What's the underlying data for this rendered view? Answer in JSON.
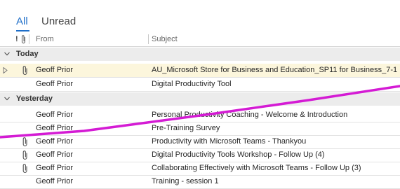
{
  "tabs": [
    {
      "label": "All",
      "selected": true
    },
    {
      "label": "Unread",
      "selected": false
    }
  ],
  "columns": {
    "importance_icon": "exclamation-icon",
    "attachment_icon": "paperclip-icon",
    "from": "From",
    "subject": "Subject"
  },
  "groups": [
    {
      "label": "Today",
      "messages": [
        {
          "from": "Geoff Prior",
          "subject": "AU_Microsoft Store for Business and Education_SP11 for Business_7-1",
          "attachment": true,
          "selected": true
        },
        {
          "from": "Geoff Prior",
          "subject": "Digital Productivity Tool",
          "attachment": false,
          "selected": false
        }
      ]
    },
    {
      "label": "Yesterday",
      "messages": [
        {
          "from": "Geoff Prior",
          "subject": "Personal Productivity Coaching - Welcome & Introduction",
          "attachment": false
        },
        {
          "from": "Geoff Prior",
          "subject": "Pre-Training Survey",
          "attachment": false
        },
        {
          "from": "Geoff Prior",
          "subject": "Productivity with Microsoft Teams - Thankyou",
          "attachment": true
        },
        {
          "from": "Geoff Prior",
          "subject": "Digital Productivity Tools Workshop - Follow Up (4)",
          "attachment": true
        },
        {
          "from": "Geoff Prior",
          "subject": "Collaborating Effectively with Microsoft Teams - Follow Up (3)",
          "attachment": true
        },
        {
          "from": "Geoff Prior",
          "subject": "Training - session 1",
          "attachment": false
        }
      ]
    }
  ],
  "colors": {
    "accent": "#1e6ec8",
    "selected_row": "#fcf6dc",
    "annotation_stroke": "#d41bd4"
  }
}
